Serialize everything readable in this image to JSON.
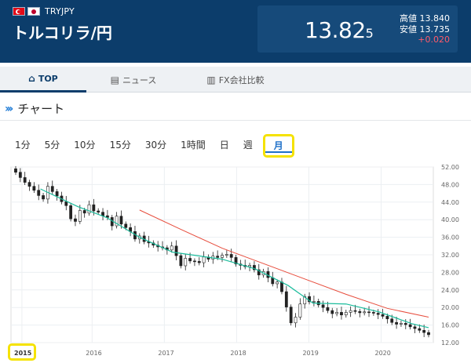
{
  "header": {
    "pair_code": "TRYJPY",
    "pair_name": "トルコリラ/円",
    "price_main": "13.82",
    "price_sub": "5",
    "high_label": "高値",
    "high_value": "13.840",
    "low_label": "安値",
    "low_value": "13.735",
    "change": "+0.020"
  },
  "tabs": [
    {
      "label": "TOP",
      "icon": "home-icon"
    },
    {
      "label": "ニュース",
      "icon": "newspaper-icon"
    },
    {
      "label": "FX会社比較",
      "icon": "building-icon"
    }
  ],
  "section": {
    "title": "チャート"
  },
  "periods": [
    "1分",
    "5分",
    "10分",
    "15分",
    "30分",
    "1時間",
    "日",
    "週",
    "月"
  ],
  "active_period": "月",
  "colors": {
    "header_bg": "#0c3d6b",
    "accent": "#1e70c8",
    "highlight": "#f5e200",
    "ma_short": "#1abc9c",
    "ma_long": "#e74c3c",
    "change": "#ff5a6a"
  },
  "chart_data": {
    "type": "candlestick",
    "title": "",
    "y_ticks": [
      "52.00",
      "48.00",
      "44.00",
      "40.00",
      "36.00",
      "32.00",
      "28.00",
      "24.00",
      "20.00",
      "16.00",
      "12.00"
    ],
    "x_ticks": [
      "2015",
      "2016",
      "2017",
      "2018",
      "2019",
      "2020"
    ],
    "ylim": [
      12,
      52
    ],
    "grid": true,
    "candles_close": [
      50.8,
      49.6,
      48.5,
      47.6,
      46.7,
      45.5,
      44.7,
      47.6,
      46.4,
      45.4,
      44.1,
      43.2,
      40.2,
      39.6,
      42.1,
      41.5,
      43.4,
      42.0,
      41.7,
      40.9,
      40.5,
      38.6,
      40.8,
      39.0,
      38.2,
      37.3,
      35.6,
      36.3,
      35.0,
      34.7,
      34.2,
      33.8,
      33.6,
      33.1,
      34.0,
      31.8,
      29.5,
      31.2,
      30.6,
      30.5,
      30.2,
      31.5,
      31.0,
      31.7,
      31.4,
      31.9,
      32.1,
      31.4,
      29.9,
      29.6,
      29.3,
      29.6,
      28.6,
      27.4,
      28.2,
      26.8,
      25.4,
      25.8,
      23.6,
      20.1,
      16.5,
      17.8,
      20.8,
      22.5,
      21.3,
      21.4,
      20.6,
      20.0,
      19.3,
      18.6,
      18.9,
      18.3,
      18.9,
      19.3,
      19.1,
      18.8,
      19.0,
      18.9,
      18.7,
      18.4,
      18.0,
      17.4,
      16.6,
      16.2,
      16.4,
      16.1,
      15.6,
      15.2,
      14.8,
      14.3,
      13.8
    ],
    "ma_short": [
      [
        0.06,
        47.0
      ],
      [
        0.15,
        43.0
      ],
      [
        0.22,
        40.5
      ],
      [
        0.3,
        36.0
      ],
      [
        0.38,
        32.6
      ],
      [
        0.5,
        31.0
      ],
      [
        0.58,
        28.8
      ],
      [
        0.66,
        25.0
      ],
      [
        0.72,
        21.0
      ],
      [
        0.8,
        20.8
      ],
      [
        0.88,
        19.0
      ],
      [
        0.96,
        16.3
      ],
      [
        1,
        15.4
      ]
    ],
    "ma_long": [
      [
        0.3,
        42.2
      ],
      [
        0.4,
        37.8
      ],
      [
        0.5,
        33.5
      ],
      [
        0.6,
        30.0
      ],
      [
        0.7,
        26.5
      ],
      [
        0.8,
        23.0
      ],
      [
        0.9,
        19.8
      ],
      [
        1,
        17.8
      ]
    ]
  }
}
